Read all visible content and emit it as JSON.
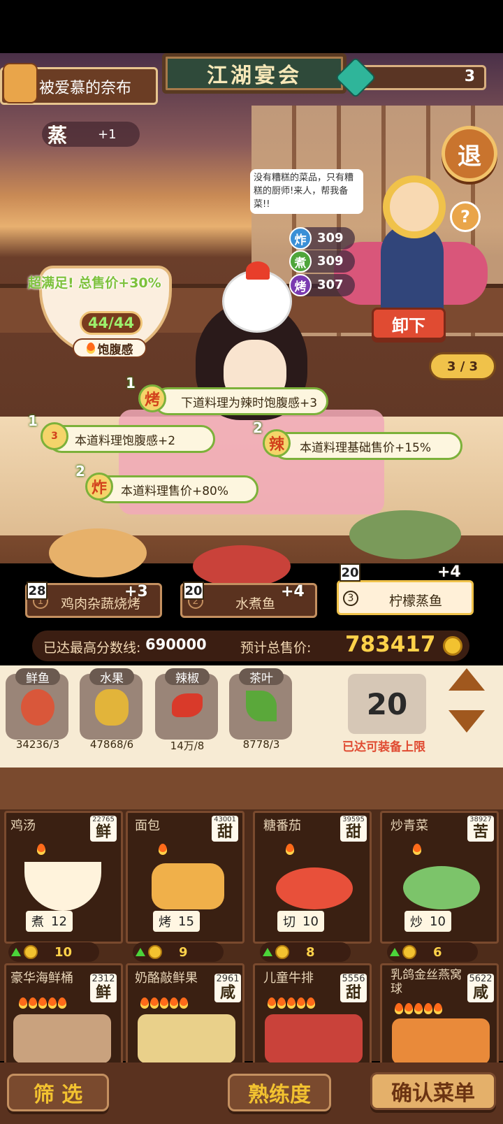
{
  "header": {
    "title": "江湖宴会",
    "player_name": "被爱慕的奈布",
    "gems": "3",
    "exit_label": "退",
    "help_label": "?"
  },
  "scene": {
    "cook_method": "蒸",
    "cook_bonus": "+1",
    "speech": "没有糟糕的菜品，只有糟糕的厨师!来人，帮我备菜!!",
    "stats": [
      {
        "icon": "炸",
        "value": "309",
        "color": "#3a8fd6"
      },
      {
        "icon": "煮",
        "value": "309",
        "color": "#4fa53a"
      },
      {
        "icon": "烤",
        "value": "307",
        "color": "#7a3ab0"
      }
    ],
    "satisfied": "超满足!  总售价+30%",
    "fullness": "44/44",
    "fullness_label": "饱腹感",
    "unload_label": "卸下",
    "page": "3 / 3"
  },
  "buffs": [
    {
      "num": "1",
      "icon": "烤",
      "text": "下道料理为辣时饱腹感+3"
    },
    {
      "num": "1",
      "icon": "3",
      "text": "本道料理饱腹感+2"
    },
    {
      "num": "2",
      "icon": "辣",
      "text": "本道料理基础售价+15%"
    },
    {
      "num": "2",
      "icon": "炸",
      "text": "本道料理售价+80%"
    }
  ],
  "selected_dishes": [
    {
      "index": "1",
      "name": "鸡肉杂蔬烧烤",
      "level": "28",
      "bonus": "+3"
    },
    {
      "index": "2",
      "name": "水煮鱼",
      "level": "20",
      "bonus": "+4"
    },
    {
      "index": "3",
      "name": "柠檬蒸鱼",
      "level": "20",
      "bonus": "+4"
    }
  ],
  "score": {
    "max_label": "已达最高分数线:",
    "max_value": "690000",
    "total_label": "预计总售价:",
    "total_value": "783417"
  },
  "ingredients": [
    {
      "name": "鲜鱼",
      "count": "34236/3",
      "color": "#d9573a"
    },
    {
      "name": "水果",
      "count": "47868/6",
      "color": "#e2b43a"
    },
    {
      "name": "辣椒",
      "count": "14万/8",
      "color": "#d93a2a"
    },
    {
      "name": "茶叶",
      "count": "8778/3",
      "color": "#5aa83a"
    }
  ],
  "equip": {
    "count": "20",
    "limit_text": "已达可装备上限"
  },
  "dishes": [
    {
      "name": "鸡汤",
      "score": "22765",
      "flavor": "鲜",
      "method": "煮",
      "level": "12",
      "price": "10"
    },
    {
      "name": "面包",
      "score": "43001",
      "flavor": "甜",
      "method": "烤",
      "level": "15",
      "price": "9"
    },
    {
      "name": "糖番茄",
      "score": "39595",
      "flavor": "甜",
      "method": "切",
      "level": "10",
      "price": "8"
    },
    {
      "name": "炒青菜",
      "score": "38927",
      "flavor": "苦",
      "method": "炒",
      "level": "10",
      "price": "6"
    },
    {
      "name": "豪华海鲜桶",
      "score": "2312",
      "flavor": "鲜"
    },
    {
      "name": "奶酪敲鲜果",
      "score": "2961",
      "flavor": "咸"
    },
    {
      "name": "儿童牛排",
      "score": "5556",
      "flavor": "甜"
    },
    {
      "name": "乳鸽金丝燕窝球",
      "score": "5622",
      "flavor": "咸"
    }
  ],
  "bottom": {
    "filter_label": "筛  选",
    "proficiency_label": "熟练度",
    "confirm_label": "确认菜单"
  }
}
